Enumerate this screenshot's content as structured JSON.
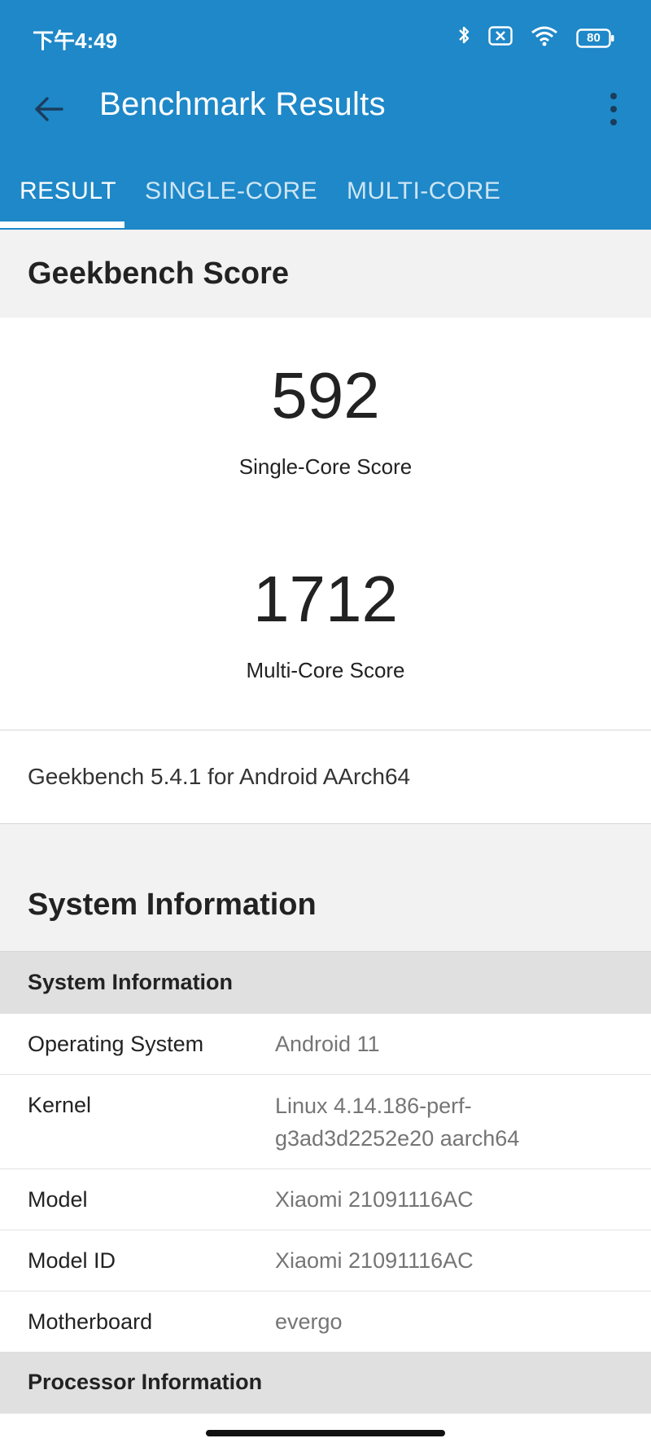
{
  "status_bar": {
    "time": "下午4:49",
    "battery": "80"
  },
  "toolbar": {
    "title": "Benchmark Results"
  },
  "tabs": [
    {
      "label": "RESULT",
      "active": true
    },
    {
      "label": "SINGLE-CORE",
      "active": false
    },
    {
      "label": "MULTI-CORE",
      "active": false
    }
  ],
  "geekbench_score": {
    "header": "Geekbench Score",
    "single_core": {
      "value": "592",
      "label": "Single-Core Score"
    },
    "multi_core": {
      "value": "1712",
      "label": "Multi-Core Score"
    },
    "version": "Geekbench 5.4.1 for Android AArch64"
  },
  "system_information": {
    "header": "System Information",
    "subheader": "System Information",
    "rows": [
      {
        "key": "Operating System",
        "value": "Android 11"
      },
      {
        "key": "Kernel",
        "value_line1": "Linux 4.14.186-perf-",
        "value_line2": "g3ad3d2252e20 aarch64"
      },
      {
        "key": "Model",
        "value": "Xiaomi 21091116AC"
      },
      {
        "key": "Model ID",
        "value": "Xiaomi 21091116AC"
      },
      {
        "key": "Motherboard",
        "value": "evergo"
      }
    ],
    "processor_subheader": "Processor Information"
  },
  "colors": {
    "primary": "#1e88c8",
    "section_bg": "#f2f2f2",
    "subheader_bg": "#e0e0e0",
    "value_text": "#757575"
  }
}
